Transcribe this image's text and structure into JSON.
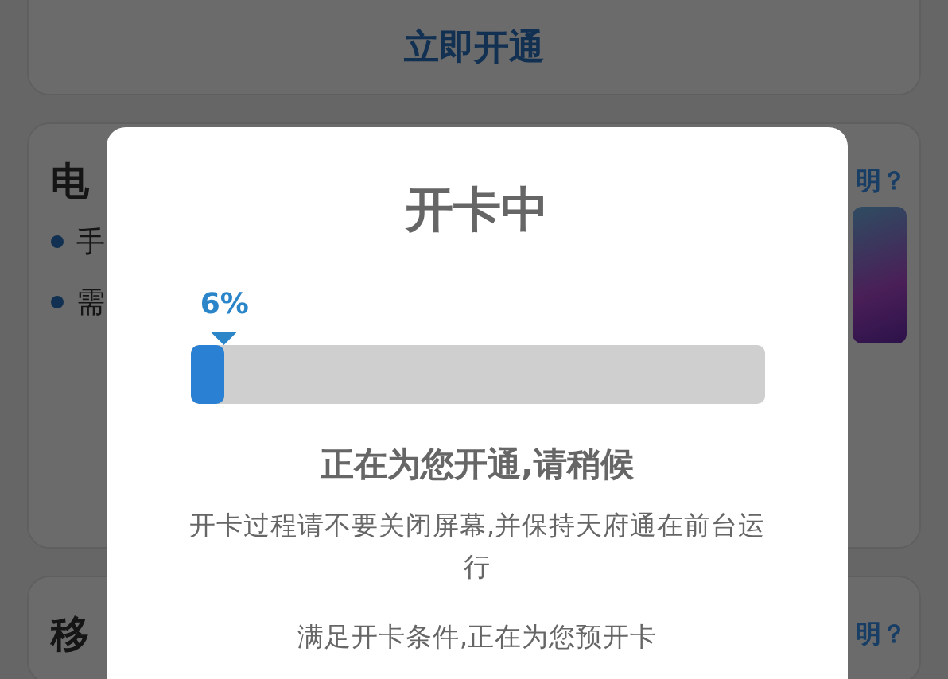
{
  "page": {
    "open_button": "立即开通",
    "cards": [
      {
        "title": "电",
        "link": "明？",
        "bullets": [
          "手",
          "需"
        ],
        "has_image": true
      },
      {
        "title": "移",
        "link": "明？",
        "has_image": false
      }
    ]
  },
  "dialog": {
    "title": "开卡中",
    "progress": {
      "label": "6%",
      "level": 0.06
    },
    "status": "正在为您开通,请稍候",
    "notice": "开卡过程请不要关闭屏幕,并保持天府通在前台运行",
    "message": "满足开卡条件,正在为您预开卡"
  }
}
